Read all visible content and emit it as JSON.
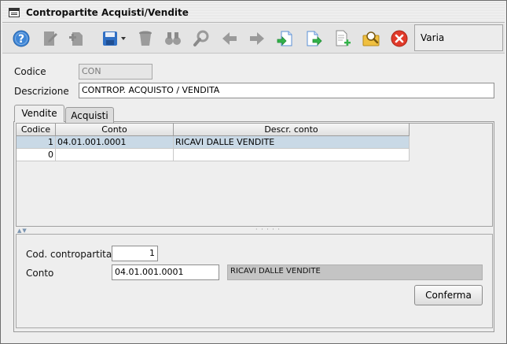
{
  "window": {
    "title": "Contropartite Acquisti/Vendite"
  },
  "toolbar": {
    "buttons": [
      {
        "name": "help-icon",
        "enabled": true
      },
      {
        "name": "edit-icon",
        "enabled": false
      },
      {
        "name": "new-icon",
        "enabled": false
      },
      {
        "name": "save-icon",
        "enabled": true
      },
      {
        "name": "delete-icon",
        "enabled": false
      },
      {
        "name": "binoculars-icon",
        "enabled": false
      },
      {
        "name": "search-icon",
        "enabled": false
      },
      {
        "name": "arrow-left-icon",
        "enabled": false
      },
      {
        "name": "arrow-right-icon",
        "enabled": false
      },
      {
        "name": "import-doc-icon",
        "enabled": true
      },
      {
        "name": "export-doc-icon",
        "enabled": true
      },
      {
        "name": "add-doc-icon",
        "enabled": true
      },
      {
        "name": "find-doc-icon",
        "enabled": true
      },
      {
        "name": "close-icon",
        "enabled": true
      }
    ],
    "varia_label": "Varia",
    "colors": {
      "help": "#3f86d6",
      "save": "#2f6fc4",
      "close": "#e03a2a",
      "green_arrow": "#33b34a",
      "disabled": "#9a9a9a"
    }
  },
  "form": {
    "codice_label": "Codice",
    "codice_value": "CON",
    "descrizione_label": "Descrizione",
    "descrizione_value": "CONTROP. ACQUISTO / VENDITA"
  },
  "tabs": [
    {
      "label": "Vendite",
      "active": true
    },
    {
      "label": "Acquisti",
      "active": false
    }
  ],
  "table": {
    "columns": [
      "Codice",
      "Conto",
      "Descr. conto"
    ],
    "rows": [
      {
        "codice": "1",
        "conto": "04.01.001.0001",
        "descr": "RICAVI DALLE VENDITE",
        "selected": true
      },
      {
        "codice": "0",
        "conto": "",
        "descr": "",
        "selected": false
      }
    ]
  },
  "detail": {
    "cod_label": "Cod. contropartita",
    "cod_value": "1",
    "conto_label": "Conto",
    "conto_value": "04.01.001.0001",
    "conto_descr": "RICAVI DALLE VENDITE",
    "confirm_label": "Conferma"
  }
}
